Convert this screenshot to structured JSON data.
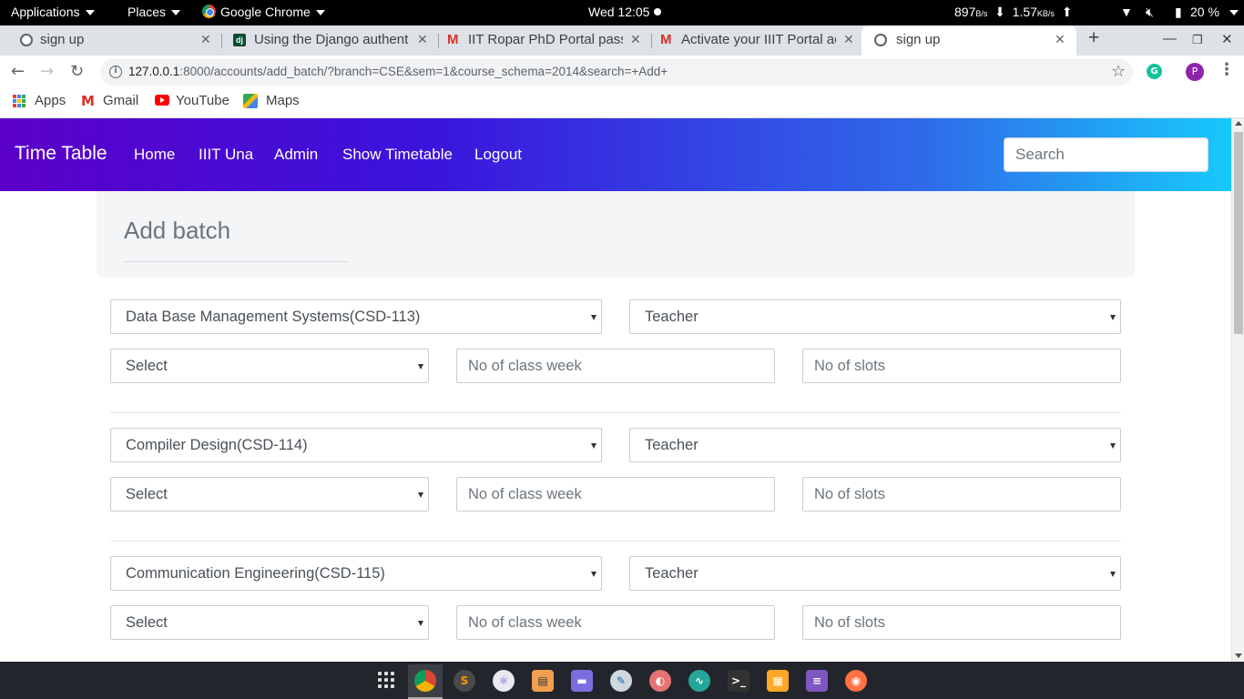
{
  "topbar": {
    "applications": "Applications",
    "places": "Places",
    "active_app": "Google Chrome",
    "clock": "Wed 12:05",
    "net_down": "897",
    "net_down_unit": "B/s",
    "net_up": "1.57",
    "net_up_unit": "KB/s",
    "battery": "20 %"
  },
  "tabs": [
    {
      "title": "sign up",
      "favicon": "globe-icon"
    },
    {
      "title": "Using the Django authent",
      "favicon": "django-icon"
    },
    {
      "title": "IIT Ropar PhD Portal pass",
      "favicon": "gmail-icon"
    },
    {
      "title": "Activate your IIIT Portal ac",
      "favicon": "gmail-icon"
    },
    {
      "title": "sign up",
      "favicon": "globe-icon",
      "active": true
    }
  ],
  "omnibox": {
    "host": "127.0.0.1",
    "path": ":8000/accounts/add_batch/?branch=CSE&sem=1&course_schema=2014&search=+Add+"
  },
  "bookmarks": [
    {
      "label": "Apps",
      "icon": "apps-grid-icon"
    },
    {
      "label": "Gmail",
      "icon": "gmail-icon"
    },
    {
      "label": "YouTube",
      "icon": "youtube-icon"
    },
    {
      "label": "Maps",
      "icon": "maps-icon"
    }
  ],
  "site_nav": {
    "brand": "Time Table",
    "links": [
      "Home",
      "IIIT Una",
      "Admin",
      "Show Timetable",
      "Logout"
    ],
    "search_placeholder": "Search",
    "gradient_colors": [
      "#5b00c8",
      "#3a14dc",
      "#2f6ae9",
      "#17c9fb"
    ]
  },
  "page": {
    "heading": "Add batch"
  },
  "batches": [
    {
      "course": "Data Base Management Systems(CSD-113)",
      "teacher": "Teacher",
      "select": "Select",
      "classes_placeholder": "No of class week",
      "slots_placeholder": "No of slots"
    },
    {
      "course": "Compiler Design(CSD-114)",
      "teacher": "Teacher",
      "select": "Select",
      "classes_placeholder": "No of class week",
      "slots_placeholder": "No of slots"
    },
    {
      "course": "Communication Engineering(CSD-115)",
      "teacher": "Teacher",
      "select": "Select",
      "classes_placeholder": "No of class week",
      "slots_placeholder": "No of slots"
    }
  ],
  "browser_chrome": {
    "profile_initial": "P"
  }
}
